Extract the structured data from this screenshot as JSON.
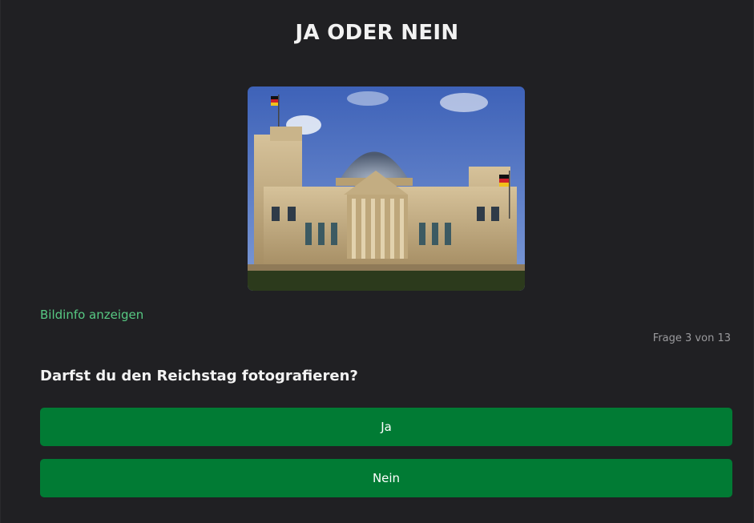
{
  "header": {
    "title": "JA ODER NEIN"
  },
  "image": {
    "icon": "reichstag-photo"
  },
  "info": {
    "link_label": "Bildinfo anzeigen"
  },
  "progress": {
    "text": "Frage 3 von 13"
  },
  "question": {
    "text": "Darfst du den Reichstag fotografieren?"
  },
  "answers": [
    {
      "label": "Ja"
    },
    {
      "label": "Nein"
    }
  ],
  "colors": {
    "background": "#202023",
    "accent_button": "#017b34",
    "link": "#57c983"
  }
}
